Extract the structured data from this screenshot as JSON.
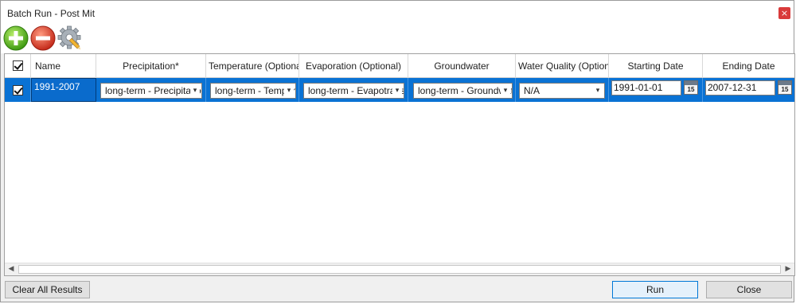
{
  "window": {
    "title": "Batch Run - Post Mit",
    "close_glyph": "×"
  },
  "toolbar": {
    "buttons": [
      {
        "icon": "add-icon",
        "color": "#5fbb2a"
      },
      {
        "icon": "remove-icon",
        "color": "#e04b3a"
      },
      {
        "icon": "settings-icon",
        "color": "#9aa3ab"
      }
    ]
  },
  "grid": {
    "columns": [
      "Name",
      "Precipitation*",
      "Temperature (Optional)",
      "Evaporation (Optional)",
      "Groundwater",
      "Water Quality (Optional)",
      "Starting Date",
      "Ending Date"
    ],
    "header_checked": true,
    "rows": [
      {
        "checked": true,
        "name": "1991-2007",
        "precipitation": "long-term - Precipitation",
        "temperature": "long-term - Temperature",
        "evaporation": "long-term - Evapotranspiration",
        "groundwater": "long-term - Groundwater",
        "water_quality": "N/A",
        "start_date": "1991-01-01",
        "end_date": "2007-12-31",
        "calendar_day": "15"
      }
    ]
  },
  "buttons": {
    "clear_all": "Clear All Results",
    "run": "Run",
    "close": "Close"
  },
  "colors": {
    "selection": "#0a72d4",
    "accent_border": "#0078d7"
  }
}
